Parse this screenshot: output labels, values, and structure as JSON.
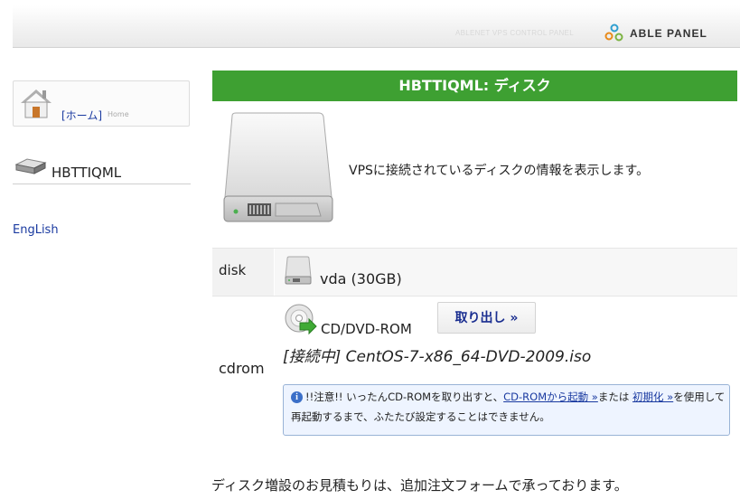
{
  "header": {
    "subtitle": "ABLENET VPS CONTROL PANEL",
    "logo_text": "ABLE PANEL"
  },
  "sidebar": {
    "home_label": "[ホーム]",
    "home_sub": "Home",
    "server_name": "HBTTIQML",
    "language_link": "EngLish"
  },
  "main": {
    "title": "HBTTIQML: ディスク",
    "intro": "VPSに接続されているディスクの情報を表示します。",
    "disk": {
      "label": "disk",
      "value": "vda (30GB)"
    },
    "cdrom": {
      "label": "cdrom",
      "device": "CD/DVD-ROM",
      "eject_button": "取り出し »",
      "iso": "[接続中] CentOS-7-x86_64-DVD-2009.iso",
      "notice": {
        "part1": "!!注意!! いったんCD-ROMを取り出すと、",
        "link1": "CD-ROMから起動 »",
        "part2": "または",
        "link2": "初期化 »",
        "part3": "を使用して再起動するまで、ふたたび設定することはできません。"
      }
    },
    "footer": "ディスク増設のお見積もりは、追加注文フォームで承っております。"
  }
}
